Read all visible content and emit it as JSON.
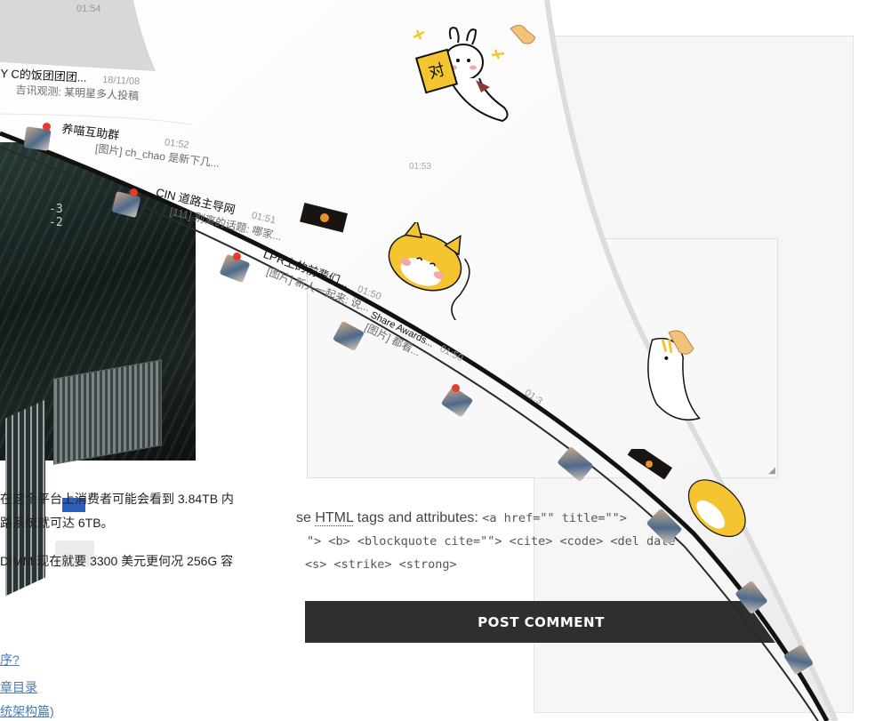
{
  "article": {
    "cpu_label": "-3\n-2",
    "paragraph_1_line_1": "在这个平台上消费者可能会看到 3.84TB 内",
    "paragraph_1_line_2": "路系统就可达 6TB。",
    "paragraph_2": "DIMM 现在就要 3300 美元更何况 256G 容",
    "links": [
      "序?",
      "章目录",
      "统架构篇)"
    ]
  },
  "comment_form": {
    "allowed_tags_prefix": "se ",
    "html_abbr": "HTML",
    "allowed_tags_suffix": " tags and attributes: ",
    "tags_line_1": "<a href=\"\" title=\"\">",
    "tags_line_2": "\"> <b> <blockquote cite=\"\"> <cite> <code> <del date",
    "tags_line_3": "<s> <strike> <strong>",
    "resize_glyph": "◢",
    "post_button_label": "POST COMMENT"
  },
  "chat_overlay": {
    "top_time": "01:54",
    "rows": [
      {
        "name": "Y C的饭团团团...",
        "msg": "吉讯观测: 某明星多人投稿",
        "time": "18/11/08"
      },
      {
        "name": "养喵互助群",
        "msg": "[图片] ch_chao 是新下几...",
        "time": "01:52"
      },
      {
        "name": "CIN 道路主导网",
        "msg": "[111] 别离的话题: 哪家...",
        "time": "01:51"
      },
      {
        "name": "LPR上的前辈们...",
        "msg": "[图片] 新人一起来: 说...",
        "time": "01:50"
      },
      {
        "name": "Share Awards...",
        "msg": "[图片] 都看...",
        "time": "01:50"
      },
      {
        "name": "",
        "msg": "",
        "time": "01:3"
      }
    ],
    "sticker_time": "01:53",
    "sticker_1_text": "对"
  },
  "colors": {
    "button_bg": "#2f2f2f",
    "link": "#4a7ab8",
    "badge": "#e33b2e",
    "sticker_yellow": "#f5c531"
  }
}
